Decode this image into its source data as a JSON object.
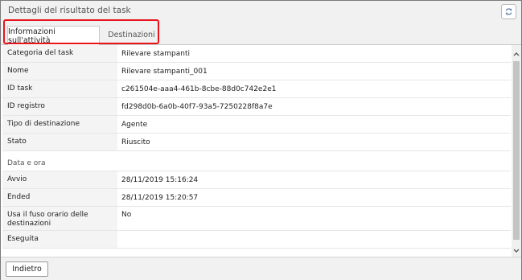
{
  "window": {
    "title": "Dettagli del risultato del task"
  },
  "tabs": [
    {
      "label": "Informazioni sull'attività",
      "active": true
    },
    {
      "label": "Destinazioni",
      "active": false
    }
  ],
  "details": [
    {
      "label": "Categoria del task",
      "value": "Rilevare stampanti"
    },
    {
      "label": "Nome",
      "value": "Rilevare stampanti_001"
    },
    {
      "label": "ID task",
      "value": "c261504e-aaa4-461b-8cbe-88d0c742e2e1"
    },
    {
      "label": "ID registro",
      "value": "fd298d0b-6a0b-40f7-93a5-7250228f8a7e"
    },
    {
      "label": "Tipo di destinazione",
      "value": "Agente"
    },
    {
      "label": "Stato",
      "value": "Riuscito"
    }
  ],
  "datetime_section": {
    "heading": "Data e ora",
    "rows": [
      {
        "label": "Avvio",
        "value": "28/11/2019 15:16:24"
      },
      {
        "label": "Ended",
        "value": "28/11/2019 15:20:57"
      },
      {
        "label": "Usa il fuso orario delle destinazioni",
        "value": "No"
      },
      {
        "label": "Eseguita",
        "value": ""
      }
    ]
  },
  "footer": {
    "back_label": "Indietro"
  },
  "colors": {
    "highlight": "#e8141b",
    "label_bg": "#f4f4f4",
    "chrome_bg": "#f1f1f1"
  },
  "icons": {
    "refresh": "refresh-icon",
    "scroll_up": "chevron-up-icon",
    "scroll_down": "chevron-down-icon"
  }
}
